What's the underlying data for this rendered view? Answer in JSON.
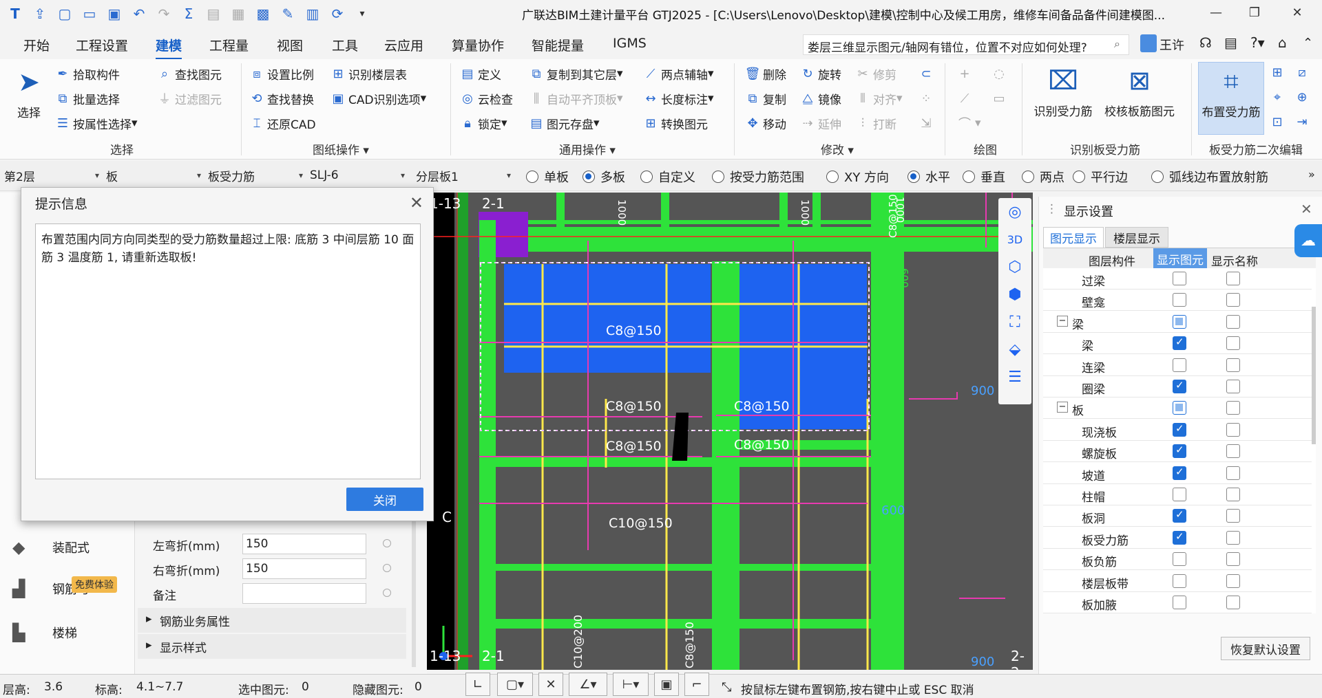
{
  "title": "广联达BIM土建计量平台 GTJ2025 - [C:\\Users\\Lenovo\\Desktop\\建模\\控制中心及候工用房，维修车间备品备件间建模图...",
  "menu": [
    "开始",
    "工程设置",
    "建模",
    "工程量",
    "视图",
    "工具",
    "云应用",
    "算量协作",
    "智能提量",
    "IGMS"
  ],
  "search_text": "娄层三维显示图元/轴网有错位，位置不对应如何处理?",
  "user": "王许",
  "ribbon": {
    "select": "选择",
    "pick": "拾取构件",
    "batch": "批量选择",
    "by_attr": "按属性选择",
    "find": "查找图元",
    "filter": "过滤图元",
    "group_select": "选择",
    "set_scale": "设置比例",
    "find_replace": "查找替换",
    "restore_cad": "还原CAD",
    "identify_floor": "识别楼层表",
    "cad_options": "CAD识别选项",
    "group_drawing": "图纸操作",
    "define": "定义",
    "cloud_check": "云检查",
    "lock": "锁定",
    "copy_to_floor": "复制到其它层",
    "auto_flat": "自动平齐顶板",
    "save_elem": "图元存盘",
    "two_point_axis": "两点辅轴",
    "length_mark": "长度标注",
    "convert_elem": "转换图元",
    "group_common": "通用操作",
    "delete": "删除",
    "copy": "复制",
    "move": "移动",
    "rotate": "旋转",
    "mirror": "镜像",
    "extend": "延伸",
    "trim": "修剪",
    "align": "对齐",
    "break": "打断",
    "group_modify": "修改",
    "group_draw": "绘图",
    "identify_rebar": "识别受力筋",
    "check_rebar": "校核板筋图元",
    "group_identify": "识别板受力筋",
    "place_rebar": "布置受力筋",
    "group_edit": "板受力筋二次编辑"
  },
  "propbar": {
    "floor": "第2层",
    "type": "板",
    "sub": "板受力筋",
    "name": "SLJ-6",
    "layer": "分层板1",
    "radios": [
      {
        "label": "单板",
        "on": false
      },
      {
        "label": "多板",
        "on": true
      },
      {
        "label": "自定义",
        "on": false
      },
      {
        "label": "按受力筋范围",
        "on": false
      },
      {
        "label": "XY 方向",
        "on": false
      },
      {
        "label": "水平",
        "on": true
      },
      {
        "label": "垂直",
        "on": false
      },
      {
        "label": "两点",
        "on": false
      },
      {
        "label": "平行边",
        "on": false
      },
      {
        "label": "弧线边布置放射筋",
        "on": false
      }
    ]
  },
  "dialog": {
    "title": "提示信息",
    "message": "布置范围内同方向同类型的受力筋数量超过上限: 底筋 3 中间层筋 10 面筋 3 温度筋 1, 请重新选取板!",
    "close": "关闭"
  },
  "props": [
    {
      "label": "左弯折(mm)",
      "value": "150"
    },
    {
      "label": "右弯折(mm)",
      "value": "150"
    },
    {
      "label": "备注",
      "value": ""
    }
  ],
  "prop_groups": [
    "钢筋业务属性",
    "显示样式"
  ],
  "side_tools": [
    "装配式",
    "钢筋与",
    "楼梯"
  ],
  "badge": "免费体验",
  "canvas_labels": {
    "axis_top1": "1-13",
    "axis_top2": "2-1",
    "axis_bot1": "1-13",
    "axis_bot2": "2-1",
    "axis_right": "2-2",
    "axis_c": "C",
    "r1": "C8@150",
    "r2": "C8@150",
    "r3": "C8@150",
    "r4": "C8@150",
    "r5": "C8@150",
    "r6": "C10@150",
    "v1": "1000",
    "v2": "1000",
    "v3": "C8@150",
    "v4": "1000",
    "v5": "600",
    "d900a": "900",
    "d600": "600",
    "d900b": "900",
    "vb1": "C10@200",
    "vb2": "C8@150"
  },
  "display_panel": {
    "title": "显示设置",
    "tab1": "图元显示",
    "tab2": "楼层显示",
    "col1": "图层构件",
    "col2": "显示图元",
    "col3": "显示名称",
    "rows": [
      {
        "label": "过梁",
        "indent": 2,
        "show": "off",
        "name": false
      },
      {
        "label": "壁龛",
        "indent": 2,
        "show": "off",
        "name": false
      },
      {
        "label": "梁",
        "indent": 1,
        "show": "part",
        "name": false,
        "expand": true
      },
      {
        "label": "梁",
        "indent": 2,
        "show": "on",
        "name": false
      },
      {
        "label": "连梁",
        "indent": 2,
        "show": "off",
        "name": false
      },
      {
        "label": "圈梁",
        "indent": 2,
        "show": "on",
        "name": false
      },
      {
        "label": "板",
        "indent": 1,
        "show": "part",
        "name": false,
        "expand": true
      },
      {
        "label": "现浇板",
        "indent": 2,
        "show": "on",
        "name": false
      },
      {
        "label": "螺旋板",
        "indent": 2,
        "show": "on",
        "name": false
      },
      {
        "label": "坡道",
        "indent": 2,
        "show": "on",
        "name": false
      },
      {
        "label": "柱帽",
        "indent": 2,
        "show": "off",
        "name": false
      },
      {
        "label": "板洞",
        "indent": 2,
        "show": "on",
        "name": false
      },
      {
        "label": "板受力筋",
        "indent": 2,
        "show": "on",
        "name": false
      },
      {
        "label": "板负筋",
        "indent": 2,
        "show": "off",
        "name": false
      },
      {
        "label": "楼层板带",
        "indent": 2,
        "show": "off",
        "name": false
      },
      {
        "label": "板加腋",
        "indent": 2,
        "show": "off",
        "name": false
      }
    ],
    "restore": "恢复默认设置"
  },
  "status": {
    "floor_h_label": "层高:",
    "floor_h": "3.6",
    "elev_label": "标高:",
    "elev": "4.1~7.7",
    "sel_label": "选中图元:",
    "sel": "0",
    "hidden_label": "隐藏图元:",
    "hidden": "0",
    "hint": "按鼠标左键布置钢筋,按右键中止或 ESC 取消"
  }
}
